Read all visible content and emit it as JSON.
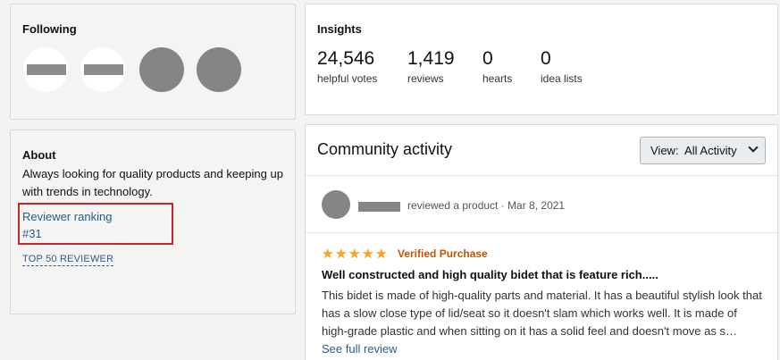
{
  "following": {
    "title": "Following",
    "avatars": [
      {
        "kind": "redacted-bar"
      },
      {
        "kind": "redacted-bar"
      },
      {
        "kind": "blurred-photo"
      },
      {
        "kind": "blurred-photo"
      }
    ]
  },
  "about": {
    "title": "About",
    "bio": "Always looking for quality products and keeping up with trends in technology.",
    "ranking_label": "Reviewer ranking",
    "ranking_value": "#31",
    "badge": "TOP 50 REVIEWER",
    "highlight_color": "#c7262e"
  },
  "insights": {
    "title": "Insights",
    "stats": [
      {
        "value": "24,546",
        "label": "helpful votes"
      },
      {
        "value": "1,419",
        "label": "reviews"
      },
      {
        "value": "0",
        "label": "hearts"
      },
      {
        "value": "0",
        "label": "idea lists"
      }
    ]
  },
  "community": {
    "title": "Community activity",
    "view_label": "View:  All Activity",
    "activity": {
      "action": "reviewed a product · Mar 8, 2021",
      "rating": 5,
      "rating_max": 5,
      "verified": "Verified Purchase",
      "review_title": "Well constructed and high quality bidet that is feature rich.....",
      "review_body": "This bidet is made of high-quality parts and material. It has a beautiful stylish look that has a slow close type of lid/seat so it doesn't slam which works well. It is made of high-grade plastic and when sitting on it has a solid feel and doesn't move as s…",
      "see_full": "See full review"
    }
  },
  "colors": {
    "link": "#2b5c8f",
    "star": "#f5a623",
    "verified": "#c45500"
  }
}
